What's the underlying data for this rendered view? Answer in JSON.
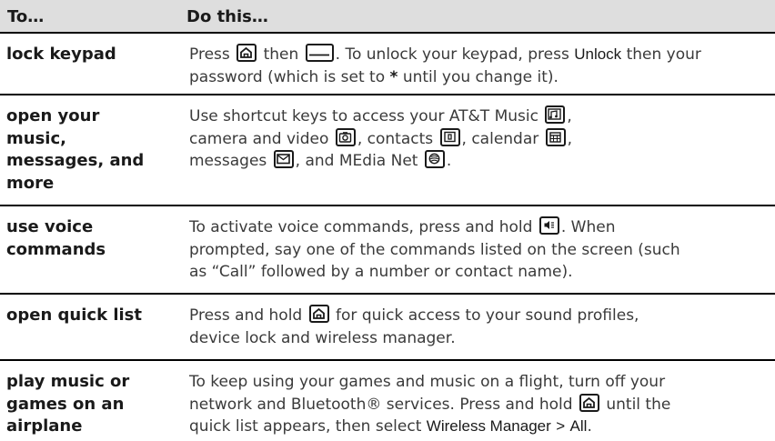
{
  "table": {
    "headers": {
      "col1": "To…",
      "col2": "Do this…"
    },
    "rows": [
      {
        "task": "lock keypad",
        "parts": {
          "p1": "Press",
          "p2": "then",
          "p3": ". To unlock your keypad, press",
          "p4": "Unlock",
          "p5": "then your password (which is set to",
          "p6": "*",
          "p7": "until you change it)."
        }
      },
      {
        "task": "open your music, messages, and more",
        "task_lines": [
          "open your",
          "music,",
          "messages, and",
          "more"
        ],
        "parts": {
          "p1": "Use shortcut keys to access your AT&T Music",
          "p2": ",",
          "p3": "camera and video",
          "p4": ", contacts",
          "p5": ", calendar",
          "p6": ",",
          "p7": "messages",
          "p8": ", and MEdia Net",
          "p9": "."
        }
      },
      {
        "task": "use voice commands",
        "task_lines": [
          "use voice",
          "commands"
        ],
        "parts": {
          "p1": "To activate voice commands, press and hold",
          "p2": ". When",
          "p3": "prompted, say one of the commands listed on the screen (such",
          "p4": "as “Call” followed by a number or contact name)."
        }
      },
      {
        "task": "open quick list",
        "parts": {
          "p1": "Press and hold",
          "p2": "for quick access to your sound profiles,",
          "p3": "device lock and wireless manager."
        }
      },
      {
        "task": "play music or games on an airplane",
        "task_lines": [
          "play music or",
          "games on an",
          "airplane"
        ],
        "parts": {
          "p1": "To keep using your games and music on a flight, turn off your",
          "p2": "network and Bluetooth® services. Press and hold",
          "p3": "until the",
          "p4": "quick list appears, then select",
          "p5": "Wireless Manager",
          "p6": ">",
          "p7": "All",
          "p8": "."
        }
      }
    ]
  },
  "icons": {
    "home_key": "home-key-icon",
    "soft_key": "right-soft-key-icon",
    "music_key": "music-key-icon",
    "camera_key": "camera-key-icon",
    "contacts_key": "contacts-key-icon",
    "calendar_key": "calendar-key-icon",
    "messages_key": "messages-key-icon",
    "media_net_key": "media-net-key-icon",
    "voice_key": "voice-key-icon"
  }
}
